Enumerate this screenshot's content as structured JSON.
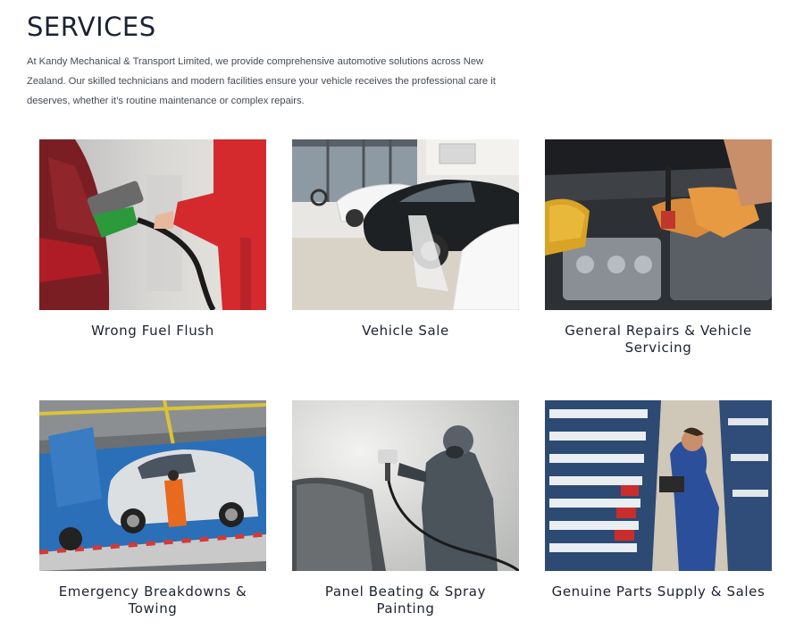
{
  "page": {
    "title": "SERVICES",
    "intro": "At Kandy Mechanical & Transport Limited, we provide comprehensive automotive solutions across New Zealand. Our skilled technicians and modern facilities ensure your vehicle receives the professional care it deserves, whether it’s routine maintenance or complex repairs."
  },
  "services": [
    {
      "label": "Wrong Fuel Flush",
      "image": "fuel-pump-photo"
    },
    {
      "label": "Vehicle Sale",
      "image": "car-showroom-photo"
    },
    {
      "label": "General Repairs & Vehicle Servicing",
      "image": "engine-repair-photo"
    },
    {
      "label": "Emergency Breakdowns & Towing",
      "image": "tow-truck-photo"
    },
    {
      "label": "Panel Beating & Spray Painting",
      "image": "spray-painting-photo"
    },
    {
      "label": "Genuine Parts Supply & Sales",
      "image": "parts-warehouse-photo"
    }
  ]
}
